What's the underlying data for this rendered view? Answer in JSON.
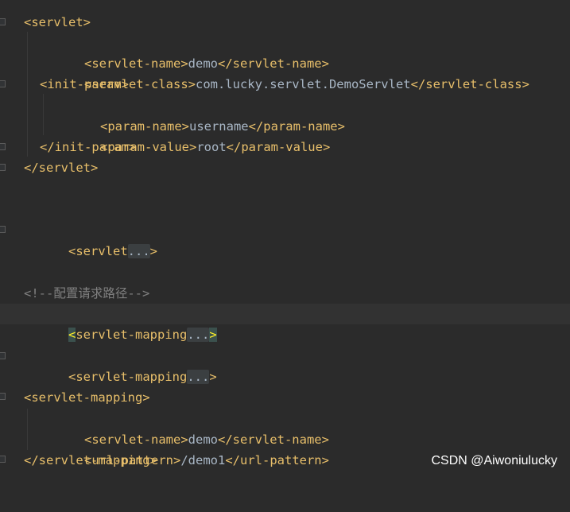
{
  "lines": [
    {
      "open": "<servlet>"
    },
    {
      "open": "<servlet-name>",
      "value": "demo",
      "close": "</servlet-name>"
    },
    {
      "open": "<servlet-class>",
      "value": "com.lucky.servlet.DemoServlet",
      "close": "</servlet-class>"
    },
    {
      "open": "<init-param>"
    },
    {
      "open": "<param-name>",
      "value": "username",
      "close": "</param-name>"
    },
    {
      "open": "<param-value>",
      "value": "root",
      "close": "</param-value>"
    },
    {
      "open": "</init-param>"
    },
    {
      "open": "</servlet>"
    },
    {
      "tag_start": "<servlet",
      "fold": "...",
      "tag_end": ">"
    },
    {
      "comment": "<!--配置请求路径-->"
    },
    {
      "tag_start": "<servlet-mapping",
      "fold": "...",
      "tag_end": ">"
    },
    {
      "tag_start": "<servlet-mapping",
      "fold": "...",
      "tag_end": ">"
    },
    {
      "open": "<servlet-mapping>"
    },
    {
      "open": "<servlet-name>",
      "value": "demo",
      "close": "</servlet-name>"
    },
    {
      "open": "<url-pattern>",
      "value": "/demo1",
      "close": "</url-pattern>"
    },
    {
      "open": "</servlet-mapping>"
    }
  ],
  "watermark": "CSDN @Aiwoniulucky",
  "colors": {
    "background": "#2b2b2b",
    "tag": "#e8bf6a",
    "text": "#a9b7c6",
    "comment": "#808080",
    "current_line": "#323232",
    "fold_placeholder": "#3b3f41",
    "bracket_highlight": "#ffef28"
  }
}
